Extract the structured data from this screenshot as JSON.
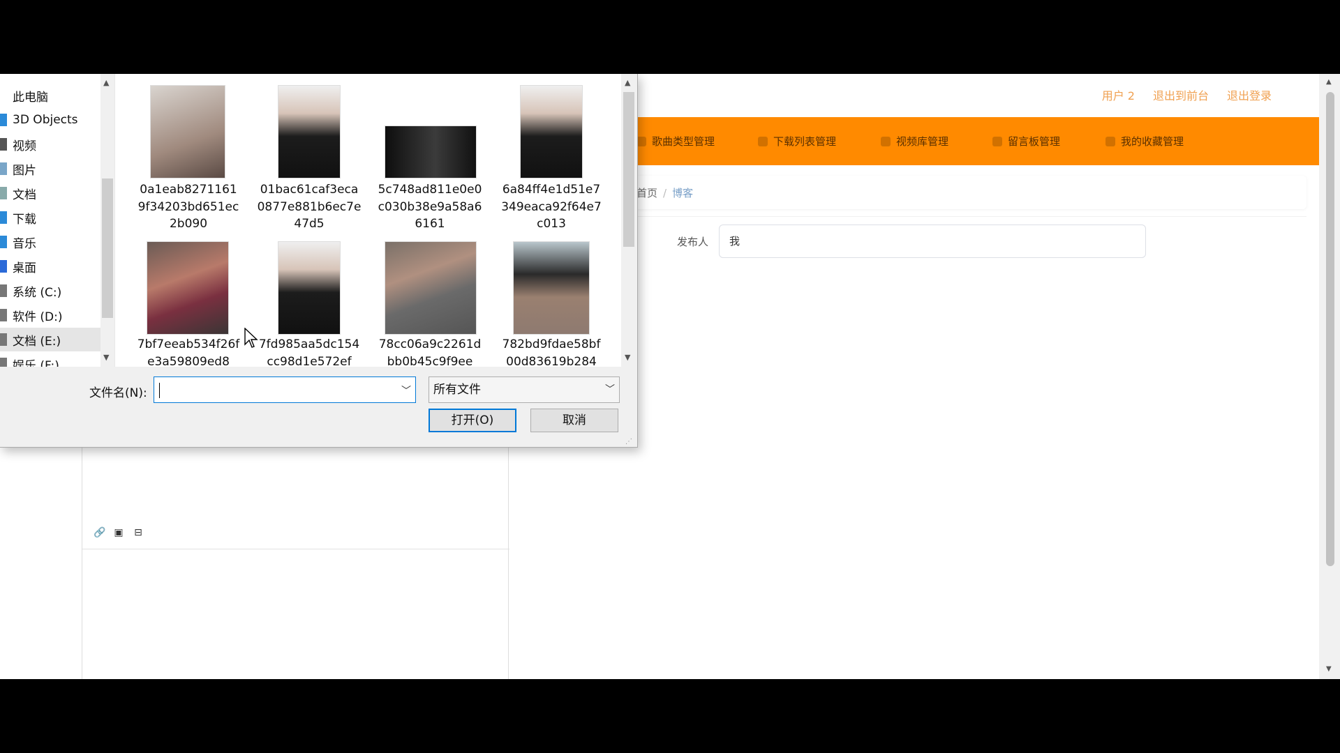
{
  "webpage": {
    "user_links": [
      "用户 2",
      "退出到前台",
      "退出登录"
    ],
    "nav_items": [
      "歌曲类型管理",
      "下载列表管理",
      "视频库管理",
      "留言板管理",
      "我的收藏管理"
    ],
    "breadcrumb": {
      "home": "首页",
      "separator": "/",
      "current": "博客"
    },
    "publisher_label": "发布人",
    "publisher_value": "我",
    "editor_tools": [
      "link-icon",
      "image-icon",
      "table-icon"
    ]
  },
  "dialog": {
    "nav_items": [
      "此电脑",
      "3D Objects",
      "视频",
      "图片",
      "文档",
      "下载",
      "音乐",
      "桌面",
      "系统 (C:)",
      "软件 (D:)",
      "文档 (E:)",
      "娱乐 (F:)"
    ],
    "selected_nav": "文档 (E:)",
    "files": [
      {
        "name": "0a1eab82711619f34203bd651ec2b090"
      },
      {
        "name": "01bac61caf3eca0877e881b6ec7e47d5"
      },
      {
        "name": "5c748ad811e0e0c030b38e9a58a66161"
      },
      {
        "name": "6a84ff4e1d51e7349eaca92f64e7c013"
      },
      {
        "name": "7bf7eeab534f26fe3a59809ed8"
      },
      {
        "name": "7fd985aa5dc154cc98d1e572ef"
      },
      {
        "name": "78cc06a9c2261dbb0b45c9f9ee"
      },
      {
        "name": "782bd9fdae58bf00d83619b284"
      }
    ],
    "filename_label": "文件名(N):",
    "filename_value": "",
    "filter_value": "所有文件",
    "open_button": "打开(O)",
    "cancel_button": "取消"
  },
  "colors": {
    "accent_orange": "#ff8a00",
    "link_orange": "#f0a050",
    "focus_blue": "#0078d7"
  }
}
